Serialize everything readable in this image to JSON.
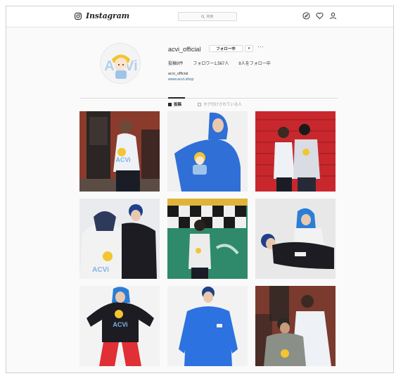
{
  "nav": {
    "logo_icon": "instagram-camera-icon",
    "wordmark": "Instagram",
    "search_placeholder": "検索",
    "icons": [
      "explore-compass-icon",
      "activity-heart-icon",
      "profile-person-icon"
    ]
  },
  "profile": {
    "username": "acvi_official",
    "follow_label": "フォロー中",
    "dropdown_label": "▾",
    "more_label": "···",
    "stats": {
      "posts": "投稿9件",
      "followers": "フォロワー1,567人",
      "following": "8人をフォロー中"
    },
    "bio_name": "acvi_official",
    "bio_link": "www.acvi.shop",
    "avatar_text": "ACVi"
  },
  "tabs": [
    {
      "label": "投稿",
      "active": true
    },
    {
      "label": "タグ付けされている人",
      "active": false
    }
  ],
  "posts": [
    {
      "id": "post-1",
      "garment": "#eef1f6",
      "bg": "#8a3b2c",
      "print": "ACVi"
    },
    {
      "id": "post-2",
      "garment": "#2f6fd6",
      "bg": "#f0f0f0",
      "print": ""
    },
    {
      "id": "post-3",
      "garment": "#d9dce3",
      "bg": "#c8282d",
      "print": ""
    },
    {
      "id": "post-4",
      "garment": "#f2f2f2",
      "bg": "#e9ebef",
      "print": "ACVi"
    },
    {
      "id": "post-5",
      "garment": "#ececec",
      "bg": "#2e8a6a",
      "print": ""
    },
    {
      "id": "post-6",
      "garment": "#1c1c22",
      "bg": "#e8e8e8",
      "print": ""
    },
    {
      "id": "post-7",
      "garment": "#1c1c22",
      "bg": "#f3f3f3",
      "print": "ACVi"
    },
    {
      "id": "post-8",
      "garment": "#2c72e0",
      "bg": "#f2f2f2",
      "print": ""
    },
    {
      "id": "post-9",
      "garment": "#8a8f88",
      "bg": "#7a3a2e",
      "print": ""
    }
  ]
}
